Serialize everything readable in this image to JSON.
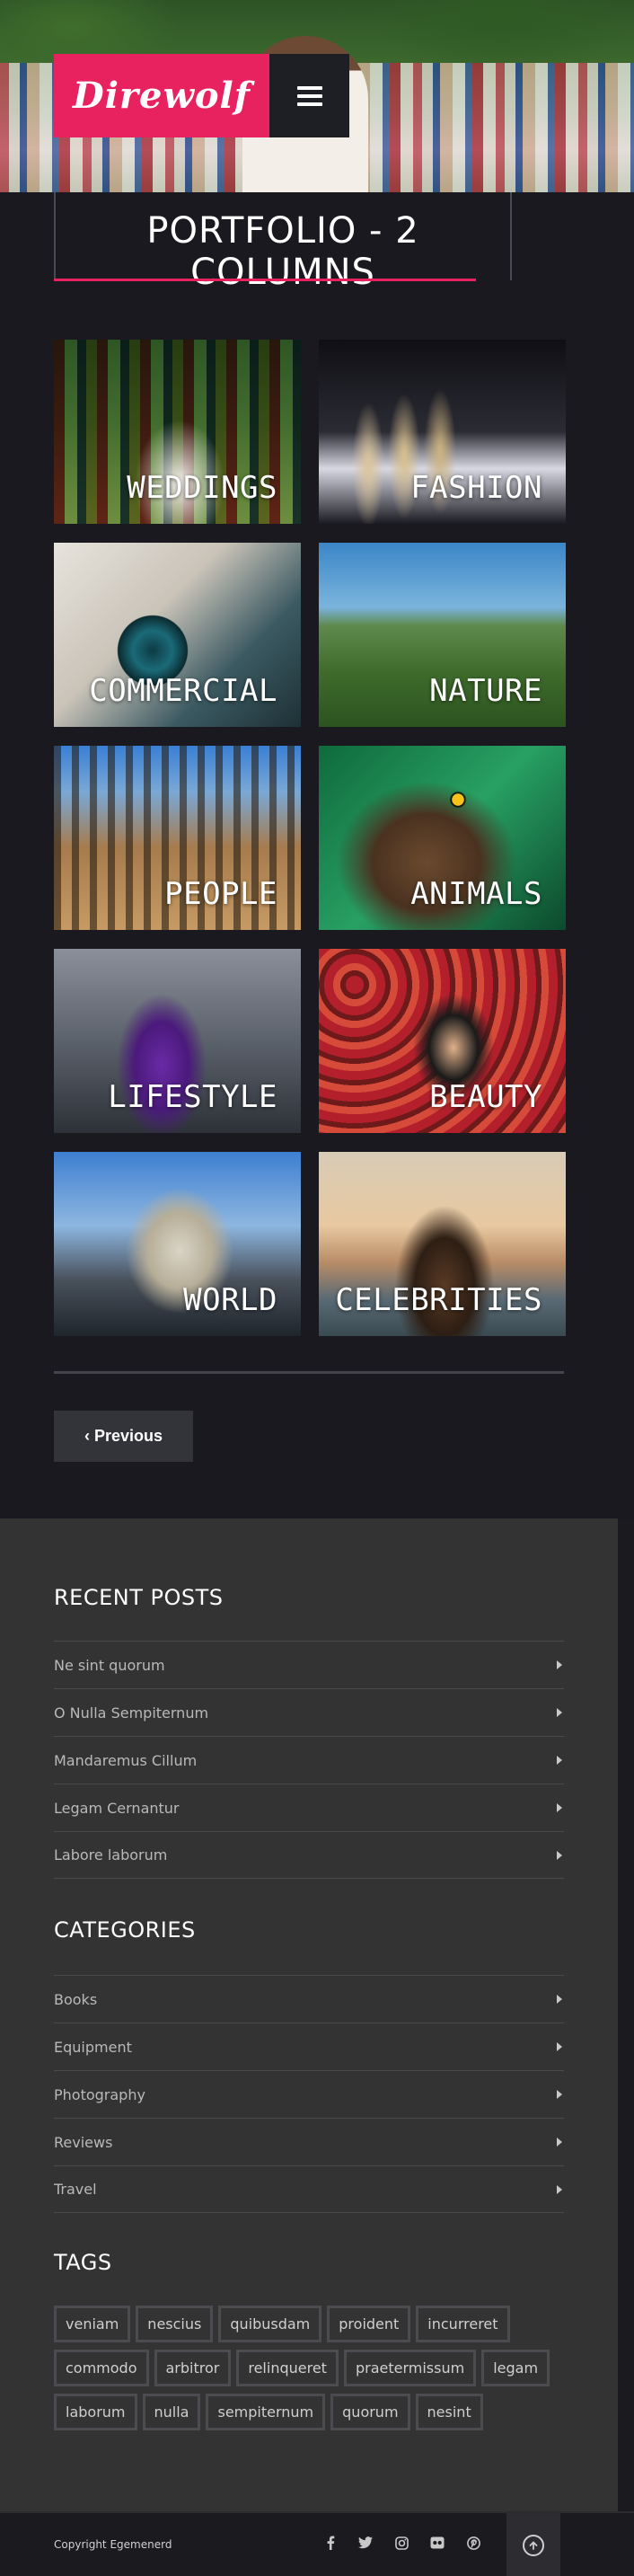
{
  "brand": {
    "name": "Direwolf",
    "accent": "#e8215f"
  },
  "header": {
    "menu_icon": "hamburger-icon"
  },
  "page": {
    "title": "PORTFOLIO - 2 COLUMNS"
  },
  "portfolio": {
    "items": [
      {
        "label": "WEDDINGS"
      },
      {
        "label": "FASHION"
      },
      {
        "label": "COMMERCIAL"
      },
      {
        "label": "NATURE"
      },
      {
        "label": "PEOPLE"
      },
      {
        "label": "ANIMALS"
      },
      {
        "label": "LIFESTYLE"
      },
      {
        "label": "BEAUTY"
      },
      {
        "label": "WORLD"
      },
      {
        "label": "CELEBRITIES"
      }
    ]
  },
  "pagination": {
    "previous_label": "‹ Previous"
  },
  "recent_posts": {
    "title": "RECENT POSTS",
    "items": [
      "Ne sint quorum",
      "O Nulla Sempiternum",
      "Mandaremus Cillum",
      "Legam Cernantur",
      "Labore laborum"
    ]
  },
  "categories": {
    "title": "CATEGORIES",
    "items": [
      "Books",
      "Equipment",
      "Photography",
      "Reviews",
      "Travel"
    ]
  },
  "tags": {
    "title": "TAGS",
    "items": [
      "veniam",
      "nescius",
      "quibusdam",
      "proident",
      "incurreret",
      "commodo",
      "arbitror",
      "relinqueret",
      "praetermissum",
      "legam",
      "laborum",
      "nulla",
      "sempiternum",
      "quorum",
      "nesint"
    ]
  },
  "footer": {
    "copyright": "Copyright Egemenerd",
    "social_icons": [
      "facebook-icon",
      "twitter-icon",
      "instagram-icon",
      "flickr-icon",
      "pinterest-icon"
    ],
    "back_to_top_icon": "arrow-up-circle-icon"
  }
}
